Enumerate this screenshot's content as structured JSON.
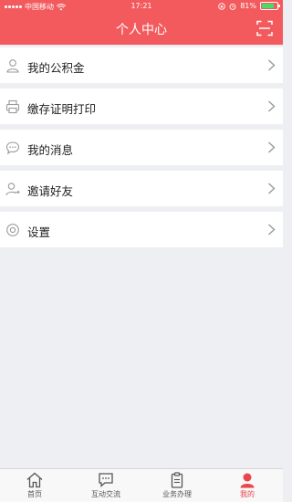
{
  "status_bar": {
    "carrier": "中国移动",
    "time": "17:21",
    "battery": "81%",
    "battery_level": 0.81
  },
  "header": {
    "title": "个人中心",
    "scan_icon": "scan-icon",
    "color": "#f35a5e"
  },
  "menu": {
    "items": [
      {
        "label": "我的公积金",
        "icon": "user-icon"
      },
      {
        "label": "缴存证明打印",
        "icon": "printer-icon"
      },
      {
        "label": "我的消息",
        "icon": "message-icon"
      },
      {
        "label": "邀请好友",
        "icon": "invite-icon"
      },
      {
        "label": "设置",
        "icon": "settings-icon"
      }
    ]
  },
  "tabbar": {
    "active_color": "#e9454a",
    "tabs": [
      {
        "label": "首页",
        "icon": "home-icon"
      },
      {
        "label": "互动交流",
        "icon": "chat-icon"
      },
      {
        "label": "业务办理",
        "icon": "clipboard-icon"
      },
      {
        "label": "我的",
        "icon": "profile-icon",
        "active": true
      }
    ]
  }
}
